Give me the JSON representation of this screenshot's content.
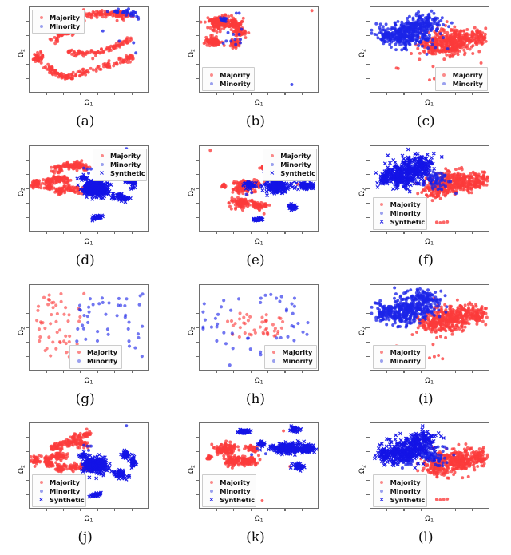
{
  "figure": {
    "rows": 4,
    "cols": 3,
    "axis_label_x": "Ω",
    "axis_label_x_sub": "1",
    "axis_label_y": "Ω",
    "axis_label_y_sub": "2",
    "tick_labels_shown": false,
    "frame_color": "#6e6e6e",
    "background": "#ffffff"
  },
  "colors": {
    "majority": "#fb3b3b",
    "majority_legend": "#fa8a8a",
    "minority": "#1b24e8",
    "minority_legend": "#9aa0ee",
    "synthetic": "#1414e6",
    "frame": "#6e6e6e",
    "legend_border": "#cccccc",
    "legend_bg": "#fcfcfc"
  },
  "legend_labels": {
    "majority": "Majority",
    "minority": "Minority",
    "synthetic": "Synthetic"
  },
  "chart_data": {
    "type": "scatter",
    "title": "",
    "xlabel": "Ω₁",
    "ylabel": "Ω₂",
    "grid": false,
    "xlim": [
      0,
      1
    ],
    "ylim": [
      0,
      1
    ],
    "tick_labels": [],
    "legend_entries": [
      "Majority",
      "Minority",
      "Synthetic"
    ],
    "series_colors": {
      "Majority": "#fb3b3b",
      "Minority": "#1b24e8",
      "Synthetic": "#1414e6"
    },
    "panels": [
      {
        "caption": "(a)",
        "row": 1,
        "col": 1,
        "legend_position": "upper-left",
        "series": [
          "Majority",
          "Minority"
        ],
        "counts": {
          "Majority": 420,
          "Minority": 40
        },
        "description": "Sparse red arc/crescent structure spanning the plot with a dense red blob at left-center; small blue minority cluster at upper right.",
        "seed": 11
      },
      {
        "caption": "(b)",
        "row": 1,
        "col": 2,
        "legend_position": "lower-left",
        "series": [
          "Majority",
          "Minority"
        ],
        "counts": {
          "Majority": 430,
          "Minority": 45
        },
        "description": "Dense red mass concentrated in upper-left quadrant with embedded blue points; one isolated red point at far top right and one isolated blue point at lower right.",
        "seed": 22
      },
      {
        "caption": "(c)",
        "row": 1,
        "col": 3,
        "legend_position": "lower-right",
        "series": [
          "Majority",
          "Minority"
        ],
        "counts": {
          "Majority": 520,
          "Minority": 500
        },
        "description": "Large overlapping cloud: blue concentrated left-of-center, red concentrated right-of-center; a few red outliers below.",
        "seed": 33
      },
      {
        "caption": "(d)",
        "row": 2,
        "col": 1,
        "legend_position": "upper-right",
        "series": [
          "Majority",
          "Minority",
          "Synthetic"
        ],
        "counts": {
          "Majority": 380,
          "Minority": 30,
          "Synthetic": 430
        },
        "description": "Red filaments on the left; dense blue synthetic blob center-right plus four detached blue satellite clusters.",
        "seed": 44
      },
      {
        "caption": "(e)",
        "row": 2,
        "col": 2,
        "legend_position": "upper-right",
        "series": [
          "Majority",
          "Minority",
          "Synthetic"
        ],
        "counts": {
          "Majority": 400,
          "Minority": 30,
          "Synthetic": 440
        },
        "description": "Red clumps center-left, blue synthetic clusters center-right plus detached blue blobs at right, bottom-center and lower-right; isolated red point upper left.",
        "seed": 55
      },
      {
        "caption": "(f)",
        "row": 2,
        "col": 3,
        "legend_position": "lower-left",
        "series": [
          "Majority",
          "Minority",
          "Synthetic"
        ],
        "counts": {
          "Majority": 520,
          "Minority": 250,
          "Synthetic": 330
        },
        "description": "Dense blue mass upper-left overlapping dense red mass lower-right; few red outliers at the bottom.",
        "seed": 66
      },
      {
        "caption": "(g)",
        "row": 3,
        "col": 1,
        "legend_position": "lower-center",
        "series": [
          "Majority",
          "Minority"
        ],
        "counts": {
          "Majority": 55,
          "Minority": 50
        },
        "description": "Sparse evenly spread points: pale red on the left half, pale blue on the right half.",
        "seed": 77
      },
      {
        "caption": "(h)",
        "row": 3,
        "col": 2,
        "legend_position": "lower-right",
        "series": [
          "Majority",
          "Minority"
        ],
        "counts": {
          "Majority": 45,
          "Minority": 48
        },
        "description": "Sparse points: pale red core in the middle ringed by pale blue points; one blue outlier at bottom left.",
        "seed": 88
      },
      {
        "caption": "(i)",
        "row": 3,
        "col": 3,
        "legend_position": "lower-left",
        "series": [
          "Majority",
          "Minority"
        ],
        "counts": {
          "Majority": 520,
          "Minority": 480
        },
        "description": "Dense overlapping cloud, blue on the left, red on the right; two red outliers near the bottom.",
        "seed": 99
      },
      {
        "caption": "(j)",
        "row": 4,
        "col": 1,
        "legend_position": "lower-left",
        "series": [
          "Majority",
          "Minority",
          "Synthetic"
        ],
        "counts": {
          "Majority": 400,
          "Minority": 25,
          "Synthetic": 470
        },
        "description": "Red filament network upper-left, dense blue synthetic cluster center, plus detached blue blobs right, lower-right and bottom-center.",
        "seed": 101
      },
      {
        "caption": "(k)",
        "row": 4,
        "col": 2,
        "legend_position": "lower-left",
        "series": [
          "Majority",
          "Minority",
          "Synthetic"
        ],
        "counts": {
          "Majority": 380,
          "Minority": 25,
          "Synthetic": 480
        },
        "description": "Red band across the left half, wide dense blue synthetic band across the right half, with detached blue blobs top-center, top-right and lower-right.",
        "seed": 112
      },
      {
        "caption": "(l)",
        "row": 4,
        "col": 3,
        "legend_position": "lower-left",
        "series": [
          "Majority",
          "Minority",
          "Synthetic"
        ],
        "counts": {
          "Majority": 520,
          "Minority": 250,
          "Synthetic": 340
        },
        "description": "Dense blue mass upper-left merging into dense red mass at right; a few red outliers along the bottom.",
        "seed": 123
      }
    ]
  }
}
